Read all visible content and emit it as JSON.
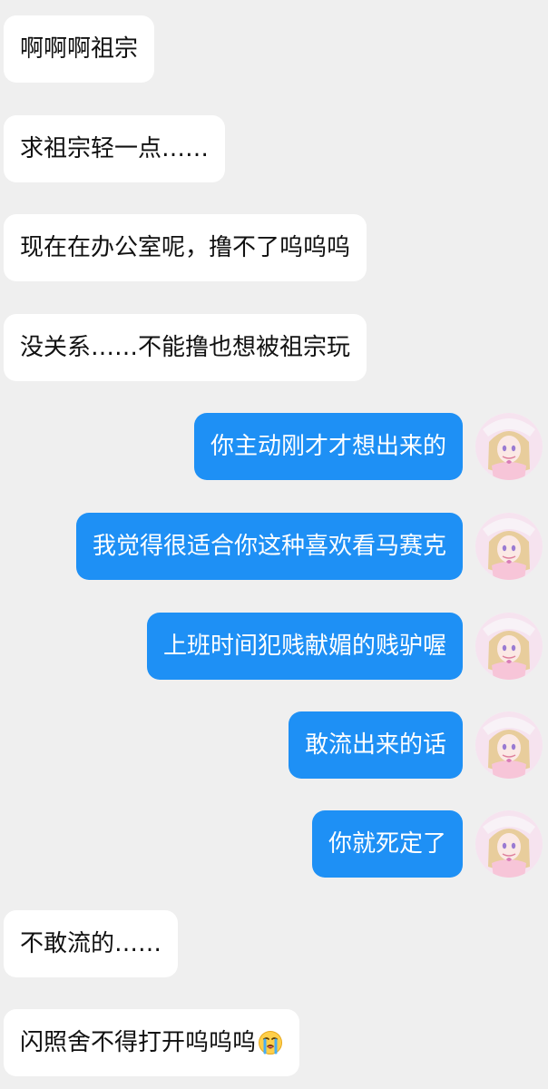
{
  "messages": [
    {
      "side": "incoming",
      "text": "啊啊啊祖宗"
    },
    {
      "side": "incoming",
      "text": "求祖宗轻一点……"
    },
    {
      "side": "incoming",
      "text": "现在在办公室呢，撸不了呜呜呜"
    },
    {
      "side": "incoming",
      "text": "没关系……不能撸也想被祖宗玩"
    },
    {
      "side": "outgoing",
      "text": "你主动刚才才想出来的"
    },
    {
      "side": "outgoing",
      "text": "我觉得很适合你这种喜欢看马赛克"
    },
    {
      "side": "outgoing",
      "text": "上班时间犯贱献媚的贱驴喔"
    },
    {
      "side": "outgoing",
      "text": "敢流出来的话"
    },
    {
      "side": "outgoing",
      "text": "你就死定了"
    },
    {
      "side": "incoming",
      "text": "不敢流的……"
    },
    {
      "side": "incoming",
      "text": "闪照舍不得打开呜呜呜",
      "emoji": "loudly-crying-face"
    }
  ],
  "colors": {
    "background": "#efefef",
    "incoming_bubble": "#ffffff",
    "outgoing_bubble": "#1e90f5",
    "outgoing_text": "#ffffff"
  }
}
